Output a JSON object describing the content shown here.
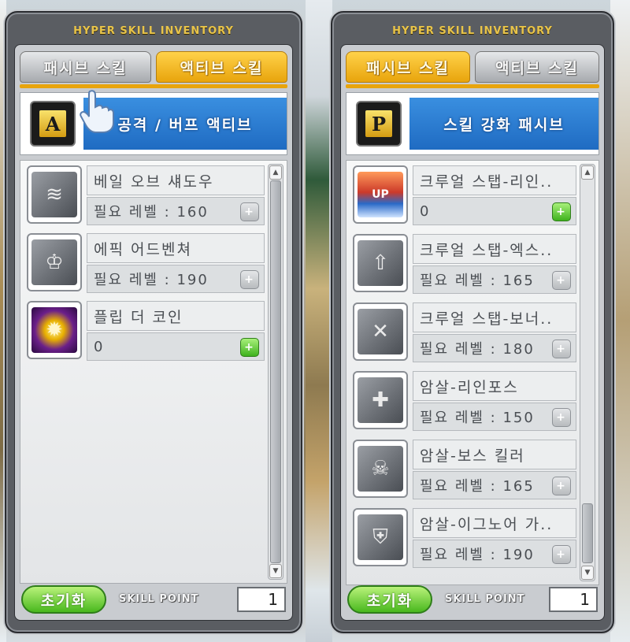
{
  "windows": [
    {
      "title": "HYPER SKILL INVENTORY",
      "tabs": [
        {
          "label": "패시브 스킬",
          "state": "inactive"
        },
        {
          "label": "액티브 스킬",
          "state": "active"
        }
      ],
      "category": {
        "icon_letter": "A",
        "label": "공격 / 버프 액티브"
      },
      "skills": [
        {
          "name": "베일 오브 섀도우",
          "level": "필요 레벨 : 160",
          "icon": "veil-of-shadow-icon",
          "plus_enabled": false
        },
        {
          "name": "에픽 어드벤쳐",
          "level": "필요 레벨 : 190",
          "icon": "epic-adventure-icon",
          "plus_enabled": false
        },
        {
          "name": "플립 더 코인",
          "level": "0",
          "icon": "flip-the-coin-icon",
          "plus_enabled": true
        }
      ],
      "footer": {
        "reset_label": "초기화",
        "sp_label": "SKILL POINT",
        "sp_value": "1"
      }
    },
    {
      "title": "HYPER SKILL INVENTORY",
      "tabs": [
        {
          "label": "패시브 스킬",
          "state": "active"
        },
        {
          "label": "액티브 스킬",
          "state": "inactive"
        }
      ],
      "category": {
        "icon_letter": "P",
        "label": "스킬 강화 패시브"
      },
      "skills": [
        {
          "name": "크루얼 스탭-리인..",
          "level": "0",
          "icon": "cruel-stab-reinforce-icon",
          "plus_enabled": true
        },
        {
          "name": "크루얼 스탭-엑스..",
          "level": "필요 레벨 : 165",
          "icon": "cruel-stab-extra-strike-icon",
          "plus_enabled": false
        },
        {
          "name": "크루얼 스탭-보너..",
          "level": "필요 레벨 : 180",
          "icon": "cruel-stab-bonus-chance-icon",
          "plus_enabled": false
        },
        {
          "name": "암살-리인포스",
          "level": "필요 레벨 : 150",
          "icon": "assassinate-reinforce-icon",
          "plus_enabled": false
        },
        {
          "name": "암살-보스 킬러",
          "level": "필요 레벨 : 165",
          "icon": "assassinate-boss-killer-icon",
          "plus_enabled": false
        },
        {
          "name": "암살-이그노어 가..",
          "level": "필요 레벨 : 190",
          "icon": "assassinate-ignore-guard-icon",
          "plus_enabled": false
        }
      ],
      "footer": {
        "reset_label": "초기화",
        "sp_label": "SKILL POINT",
        "sp_value": "1"
      }
    }
  ],
  "colors": {
    "active_tab": "#e8a40c",
    "banner": "#1f6bc2",
    "green_button": "#49b81e"
  }
}
